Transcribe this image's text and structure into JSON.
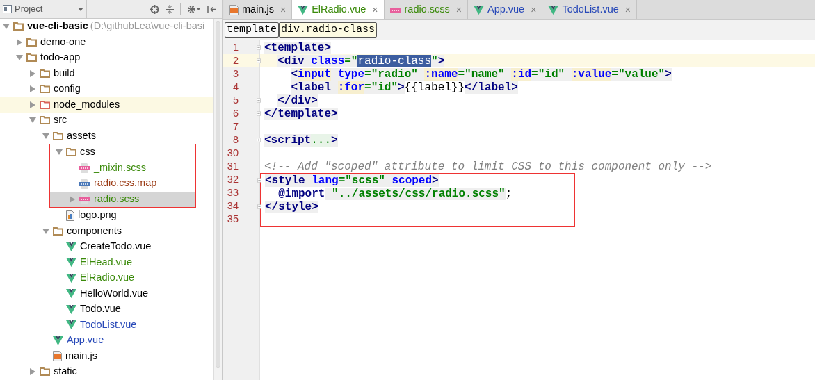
{
  "project_panel": {
    "title": "Project",
    "tree": [
      {
        "label": "vue-cli-basic",
        "path": "(D:\\githubLea\\vue-cli-basi",
        "kind": "folder",
        "expanded": true,
        "selected": false,
        "color": "#000000",
        "children": [
          {
            "label": "demo-one",
            "kind": "folder",
            "expanded": false,
            "selected": false,
            "color": "#000000"
          },
          {
            "label": "todo-app",
            "kind": "folder",
            "expanded": true,
            "selected": false,
            "color": "#000000",
            "children": [
              {
                "label": "build",
                "kind": "folder",
                "expanded": false,
                "selected": false,
                "color": "#000000"
              },
              {
                "label": "config",
                "kind": "folder",
                "expanded": false,
                "selected": false,
                "color": "#000000"
              },
              {
                "label": "node_modules",
                "kind": "excluded",
                "expanded": false,
                "selected": false,
                "highlighted": true,
                "color": "#000000"
              },
              {
                "label": "src",
                "kind": "folder",
                "expanded": true,
                "selected": false,
                "color": "#000000",
                "children": [
                  {
                    "label": "assets",
                    "kind": "folder",
                    "expanded": true,
                    "selected": false,
                    "color": "#000000",
                    "children": [
                      {
                        "label": "css",
                        "kind": "folder",
                        "expanded": true,
                        "selected": false,
                        "framed": true,
                        "color": "#000000",
                        "children": [
                          {
                            "label": "_mixin.scss",
                            "kind": "sass",
                            "selected": false,
                            "color": "#3a8a0a"
                          },
                          {
                            "label": "radio.css.map",
                            "kind": "json",
                            "selected": false,
                            "color": "#9c3d17"
                          },
                          {
                            "label": "radio.scss",
                            "kind": "sass",
                            "expanded": false,
                            "selected": true,
                            "color": "#3a8a0a"
                          }
                        ]
                      },
                      {
                        "label": "logo.png",
                        "kind": "image",
                        "selected": false,
                        "color": "#000000"
                      }
                    ]
                  },
                  {
                    "label": "components",
                    "kind": "folder",
                    "expanded": true,
                    "selected": false,
                    "color": "#000000",
                    "children": [
                      {
                        "label": "CreateTodo.vue",
                        "kind": "vue",
                        "selected": false,
                        "color": "#000000"
                      },
                      {
                        "label": "ElHead.vue",
                        "kind": "vue",
                        "selected": false,
                        "color": "#3a8a0a"
                      },
                      {
                        "label": "ElRadio.vue",
                        "kind": "vue",
                        "selected": false,
                        "color": "#3a8a0a"
                      },
                      {
                        "label": "HelloWorld.vue",
                        "kind": "vue",
                        "selected": false,
                        "color": "#000000"
                      },
                      {
                        "label": "Todo.vue",
                        "kind": "vue",
                        "selected": false,
                        "color": "#000000"
                      },
                      {
                        "label": "TodoList.vue",
                        "kind": "vue",
                        "selected": false,
                        "color": "#2849b8"
                      }
                    ]
                  },
                  {
                    "label": "App.vue",
                    "kind": "vue",
                    "selected": false,
                    "color": "#2849b8"
                  },
                  {
                    "label": "main.js",
                    "kind": "js",
                    "selected": false,
                    "color": "#000000"
                  }
                ]
              },
              {
                "label": "static",
                "kind": "folder",
                "expanded": false,
                "selected": false,
                "color": "#000000"
              }
            ]
          }
        ]
      }
    ]
  },
  "editor": {
    "tabs": [
      {
        "label": "main.js",
        "kind": "js",
        "selected": false,
        "color": "#000000"
      },
      {
        "label": "ElRadio.vue",
        "kind": "vue",
        "selected": true,
        "color": "#3a8a0a"
      },
      {
        "label": "radio.scss",
        "kind": "sass",
        "selected": false,
        "color": "#3a8a0a"
      },
      {
        "label": "App.vue",
        "kind": "vue",
        "selected": false,
        "color": "#2849b8"
      },
      {
        "label": "TodoList.vue",
        "kind": "vue",
        "selected": false,
        "color": "#2849b8"
      }
    ],
    "close_glyph": "×",
    "breadcrumbs": [
      {
        "label": "template",
        "selected": false
      },
      {
        "label": "div.radio-class",
        "selected": true
      }
    ],
    "lines": [
      {
        "number": "1",
        "fold_start": true,
        "current": false,
        "tokens": [
          {
            "kind": "tag",
            "text": "<template>"
          }
        ]
      },
      {
        "number": "2",
        "fold_start": true,
        "current": true,
        "tokens": [
          {
            "kind": "tag",
            "text": "  <div "
          },
          {
            "kind": "attr",
            "text": "class"
          },
          {
            "kind": "str",
            "text": "=\""
          },
          {
            "kind": "selection",
            "text": "radio-class"
          },
          {
            "kind": "str",
            "text": "\""
          },
          {
            "kind": "tag",
            "text": ">"
          }
        ]
      },
      {
        "number": "3",
        "current": false,
        "tokens": [
          {
            "kind": "tag",
            "text": "    <"
          },
          {
            "kind": "bound",
            "text": "input"
          },
          {
            "kind": "attr",
            "text": " type"
          },
          {
            "kind": "str",
            "text": "=\"radio\" "
          },
          {
            "kind": "bound",
            "text": ":name"
          },
          {
            "kind": "str",
            "text": "=\"name\" "
          },
          {
            "kind": "bound",
            "text": ":id"
          },
          {
            "kind": "str",
            "text": "=\"id\" "
          },
          {
            "kind": "bound",
            "text": ":value"
          },
          {
            "kind": "str",
            "text": "=\"value\""
          },
          {
            "kind": "tag",
            "text": ">"
          }
        ]
      },
      {
        "number": "4",
        "current": false,
        "tokens": [
          {
            "kind": "tag",
            "text": "    <label "
          },
          {
            "kind": "bound",
            "text": ":for"
          },
          {
            "kind": "str",
            "text": "=\"id\""
          },
          {
            "kind": "tag",
            "text": ">"
          },
          {
            "kind": "text",
            "text": "{{label}}"
          },
          {
            "kind": "tag",
            "text": "</label>"
          }
        ]
      },
      {
        "number": "5",
        "fold_end": true,
        "current": false,
        "tokens": [
          {
            "kind": "tag",
            "text": "  </div>"
          }
        ]
      },
      {
        "number": "6",
        "fold_end": true,
        "current": false,
        "tokens": [
          {
            "kind": "tag",
            "text": "</template>"
          }
        ]
      },
      {
        "number": "7",
        "current": false
      },
      {
        "number": "8",
        "collapsed": true,
        "current": false,
        "tokens": [
          {
            "kind": "tag",
            "text": "<script"
          },
          {
            "kind": "folded",
            "text": "..."
          },
          {
            "kind": "tag",
            "text": ">"
          }
        ]
      },
      {
        "number": "30",
        "current": false
      },
      {
        "number": "31",
        "current": false,
        "tokens": [
          {
            "kind": "comment",
            "text": "<!-- Add \"scoped\" attribute to limit CSS to this component only -->"
          }
        ]
      },
      {
        "number": "32",
        "fold_start": true,
        "current": false,
        "framed": true,
        "tokens": [
          {
            "kind": "tag",
            "text": "<style "
          },
          {
            "kind": "attr",
            "text": "lang"
          },
          {
            "kind": "str",
            "text": "=\"scss\""
          },
          {
            "kind": "attr",
            "text": " scoped"
          },
          {
            "kind": "tag",
            "text": ">"
          }
        ]
      },
      {
        "number": "33",
        "current": false,
        "framed": true,
        "tokens": [
          {
            "kind": "keyword",
            "text": "  @import"
          },
          {
            "kind": "str",
            "text": " \"../assets/css/radio.scss\""
          },
          {
            "kind": "text",
            "text": ";"
          }
        ]
      },
      {
        "number": "34",
        "fold_end": true,
        "current": false,
        "framed": true,
        "tokens": [
          {
            "kind": "tag",
            "text": "</style>"
          }
        ]
      },
      {
        "number": "35",
        "current": false,
        "framed": true
      }
    ]
  }
}
